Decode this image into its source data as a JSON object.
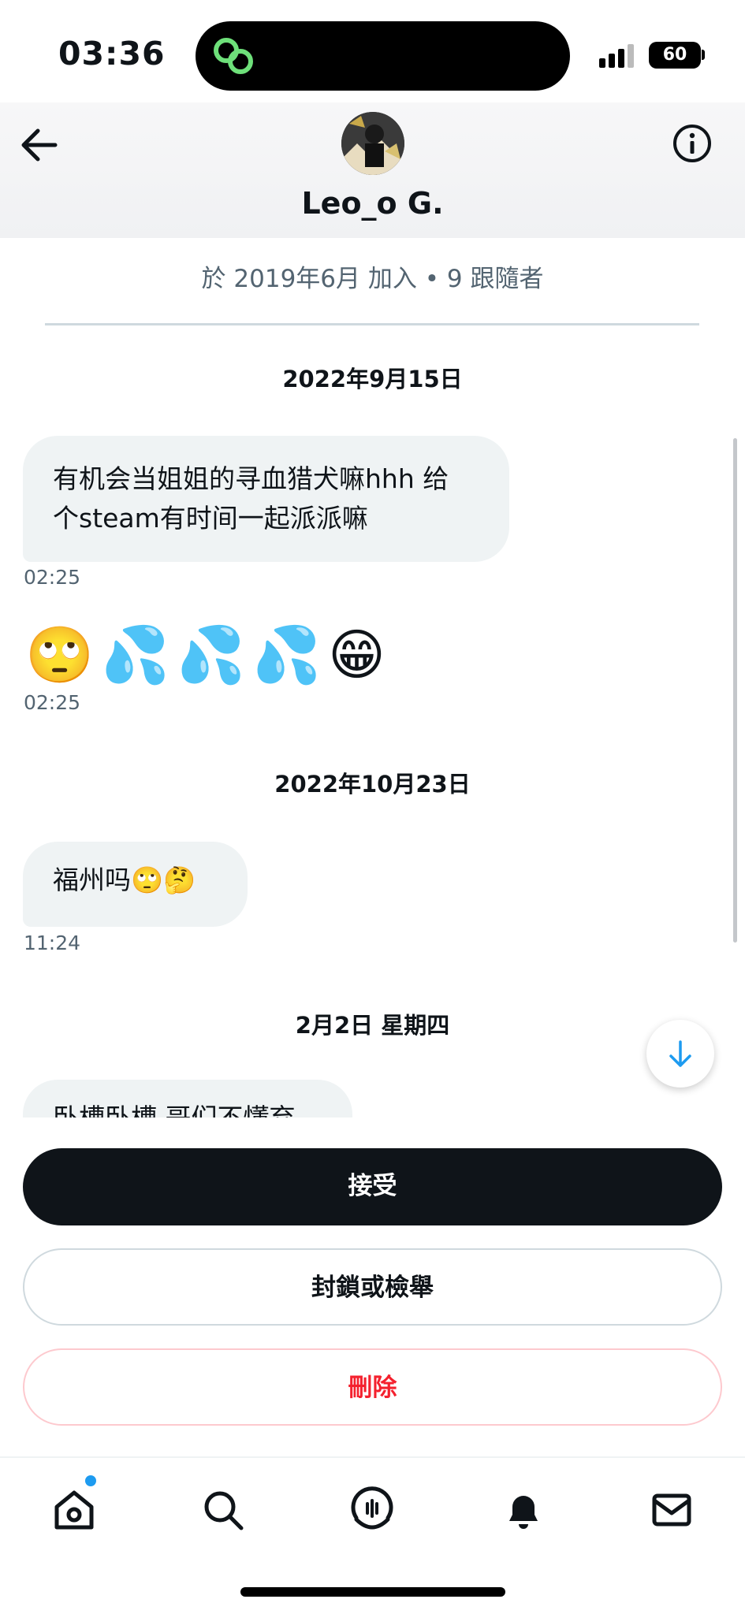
{
  "status_bar": {
    "time": "03:36",
    "battery": "60"
  },
  "header": {
    "display_name": "Leo_o G."
  },
  "profile": {
    "join_info": "於 2019年6月 加入 • 9 跟隨者"
  },
  "messages": [
    {
      "date": "2022年9月15日"
    },
    {
      "text_line1": "有机会当姐姐的寻血猎犬嘛hhh 给",
      "text_line2": "个steam有时间一起派派嘛",
      "time": "02:25"
    },
    {
      "emojis": [
        "🙄",
        "💦",
        "💦",
        "💦",
        "😁"
      ],
      "time": "02:25"
    },
    {
      "date": "2022年10月23日"
    },
    {
      "text": "福州吗🙄🤔",
      "time": "11:24"
    },
    {
      "date": "2月2日 星期四"
    },
    {
      "text": "卧槽卧槽 哥们不懂弃"
    }
  ],
  "actions": {
    "accept": "接受",
    "block_report": "封鎖或檢舉",
    "delete": "刪除"
  },
  "nav": [
    "home-icon",
    "search-icon",
    "spaces-icon",
    "notifications-icon",
    "messages-icon"
  ],
  "colors": {
    "accent": "#1d9bf0",
    "delete": "#f4212e",
    "primary_button": "#0f1419"
  }
}
